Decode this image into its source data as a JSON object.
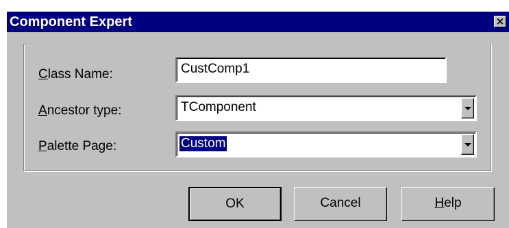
{
  "window": {
    "title": "Component Expert",
    "close_glyph": "×"
  },
  "form": {
    "class_name": {
      "label_first": "C",
      "label_rest": "lass Name:",
      "value": "CustComp1"
    },
    "ancestor_type": {
      "label_first": "A",
      "label_rest": "ncestor type:",
      "value": "TComponent"
    },
    "palette_page": {
      "label_first": "P",
      "label_rest": "alette Page:",
      "value": "Custom"
    }
  },
  "buttons": {
    "ok": "OK",
    "cancel": "Cancel",
    "help_first": "H",
    "help_rest": "elp"
  },
  "icons": {
    "close": "close-icon",
    "dropdown": "chevron-down-icon"
  },
  "colors": {
    "titlebar": "#000080",
    "face": "#c0c0c0",
    "selection": "#000080"
  }
}
